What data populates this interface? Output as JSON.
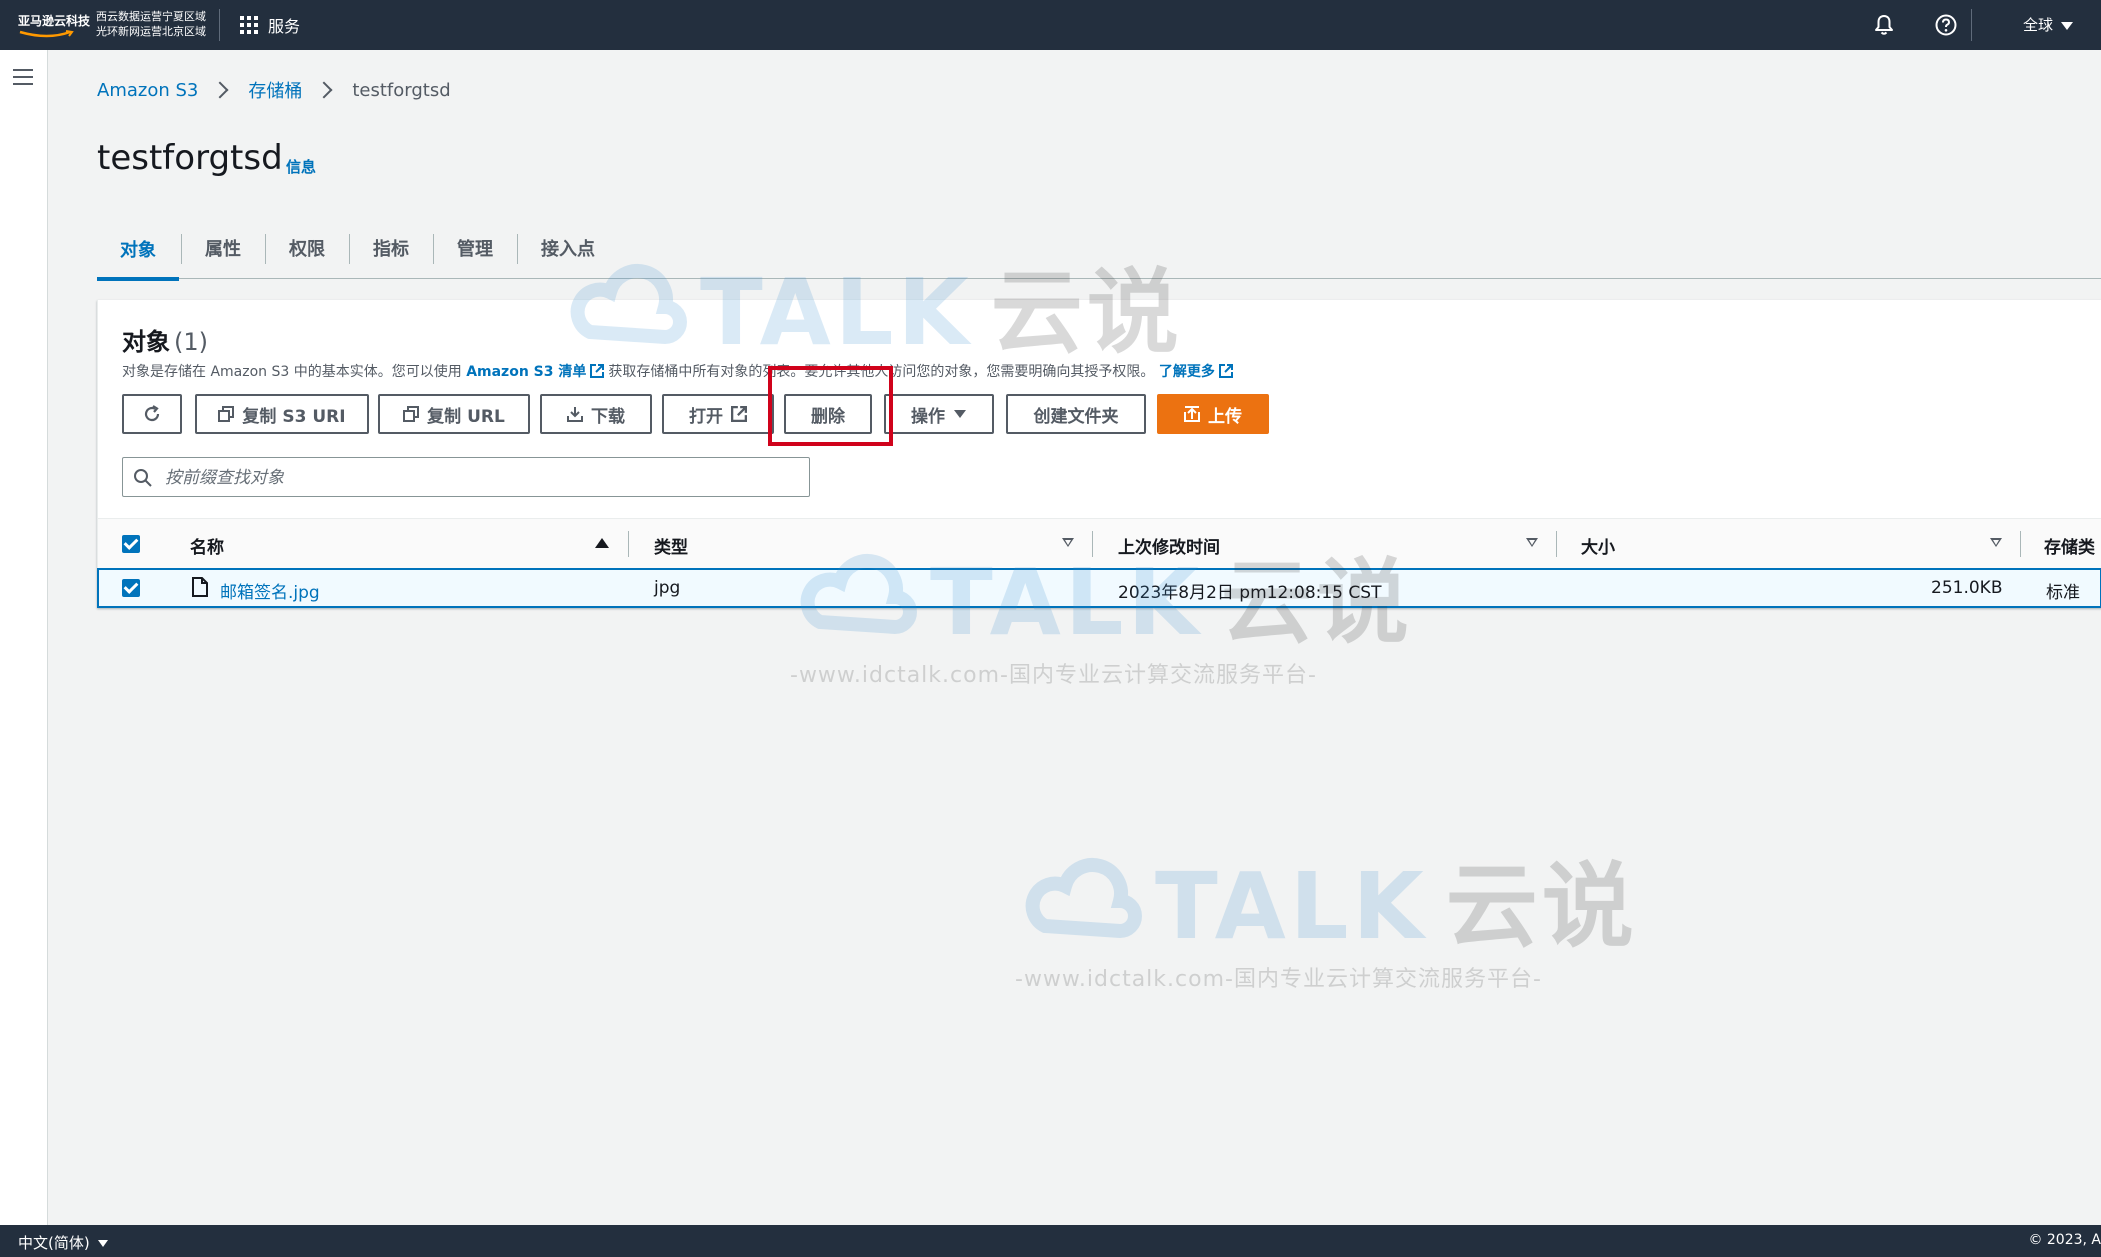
{
  "topnav": {
    "logo_text": "亚马逊云科技",
    "region_line1": "西云数据运营宁夏区域",
    "region_line2": "光环新网运营北京区域",
    "services_label": "服务",
    "global_label": "全球"
  },
  "breadcrumb": {
    "items": [
      "Amazon S3",
      "存储桶",
      "testforgtsd"
    ]
  },
  "page": {
    "title": "testforgtsd",
    "info_label": "信息"
  },
  "tabs": [
    {
      "label": "对象",
      "active": true
    },
    {
      "label": "属性"
    },
    {
      "label": "权限"
    },
    {
      "label": "指标"
    },
    {
      "label": "管理"
    },
    {
      "label": "接入点"
    }
  ],
  "objects": {
    "title": "对象",
    "count": "(1)",
    "desc_prefix": "对象是存储在 Amazon S3 中的基本实体。您可以使用",
    "desc_link": "Amazon S3 清单",
    "desc_middle": "获取存储桶中所有对象的列表。要允许其他人访问您的对象，您需要明确向其授予权限。",
    "desc_learn_more": "了解更多",
    "buttons": {
      "copy_s3_uri": "复制 S3 URI",
      "copy_url": "复制 URL",
      "download": "下载",
      "open": "打开",
      "delete": "删除",
      "actions": "操作",
      "create_folder": "创建文件夹",
      "upload": "上传"
    },
    "search_placeholder": "按前缀查找对象",
    "columns": [
      "名称",
      "类型",
      "上次修改时间",
      "大小",
      "存储类"
    ],
    "rows": [
      {
        "name": "邮箱签名.jpg",
        "type": "jpg",
        "last_modified": "2023年8月2日 pm12:08:15 CST",
        "size": "251.0KB",
        "storage_class": "标准",
        "selected": true
      }
    ]
  },
  "watermark": {
    "brand": "TALK",
    "brand_cn": "云说",
    "subtitle": "-www.idctalk.com-国内专业云计算交流服务平台-"
  },
  "footer": {
    "language": "中文(简体)",
    "copyright": "© 2023, A"
  },
  "colors": {
    "nav_bg": "#232f3e",
    "link": "#0073bb",
    "primary_button": "#ec7211",
    "highlight": "#d0021b"
  }
}
